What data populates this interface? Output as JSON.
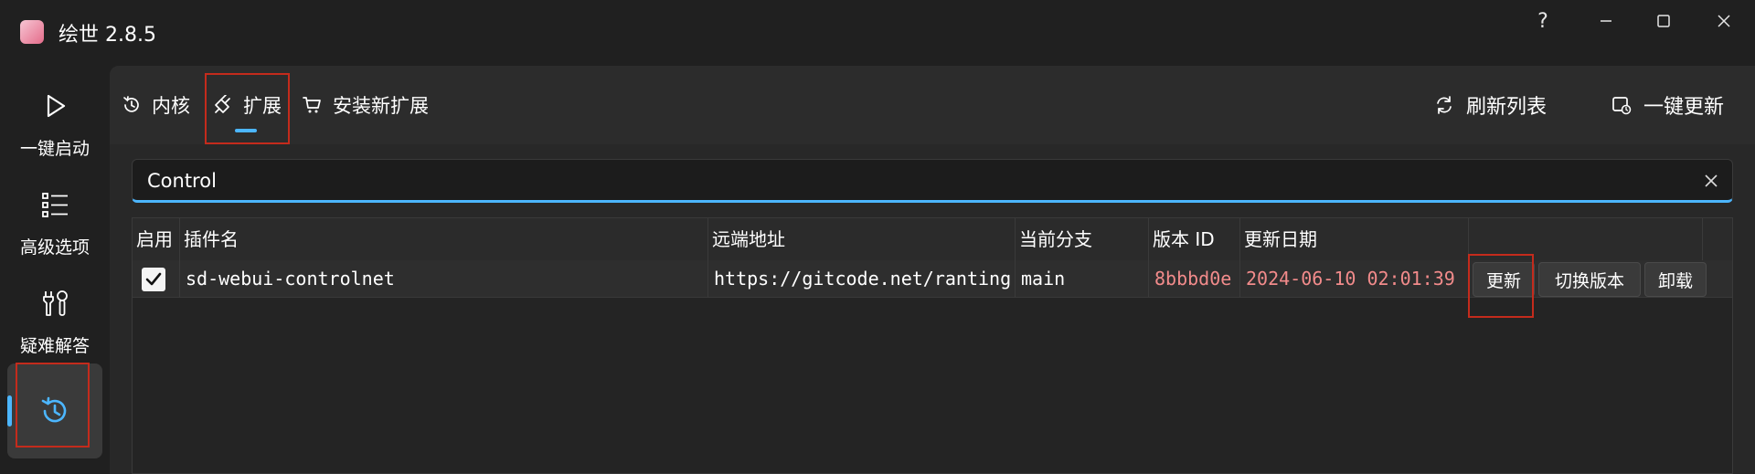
{
  "window": {
    "title": "绘世 2.8.5",
    "help_label": "?"
  },
  "sidebar": {
    "items": [
      {
        "label": "一键启动",
        "icon": "play-icon"
      },
      {
        "label": "高级选项",
        "icon": "list-icon"
      },
      {
        "label": "疑难解答",
        "icon": "tools-icon"
      },
      {
        "label": "",
        "icon": "history-icon",
        "active": true
      }
    ]
  },
  "tabs": {
    "items": [
      {
        "label": "内核",
        "icon": "history-icon"
      },
      {
        "label": "扩展",
        "icon": "plug-icon",
        "selected": true
      },
      {
        "label": "安装新扩展",
        "icon": "cart-icon"
      }
    ]
  },
  "actions": {
    "refresh_label": "刷新列表",
    "update_all_label": "一键更新"
  },
  "search": {
    "value": "Control"
  },
  "table": {
    "headers": [
      "启用",
      "插件名",
      "远端地址",
      "当前分支",
      "版本 ID",
      "更新日期"
    ],
    "rows": [
      {
        "enabled": true,
        "name": "sd-webui-controlnet",
        "remote": "https://gitcode.net/ranting",
        "branch": "main",
        "version_id": "8bbbd0e",
        "updated": "2024-06-10 02:01:39",
        "buttons": {
          "update": "更新",
          "switch": "切换版本",
          "uninstall": "卸载"
        }
      }
    ]
  },
  "colors": {
    "accent": "#4cb6ff",
    "highlight_box": "#c42b1c",
    "version_text": "#f28b8b"
  }
}
